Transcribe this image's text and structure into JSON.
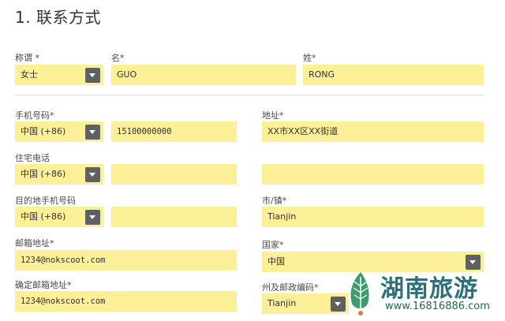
{
  "section_title": "1. 联系方式",
  "salutation": {
    "label": "称谓 *",
    "value": "女士"
  },
  "first_name": {
    "label": "名*",
    "value": "GUO"
  },
  "last_name": {
    "label": "姓*",
    "value": "RONG"
  },
  "mobile": {
    "label": "手机号码*",
    "code": "中国 (+86)",
    "number": "15100000000"
  },
  "address": {
    "label": "地址*",
    "line1": "XX市XX区XX街道",
    "line2": ""
  },
  "home_phone": {
    "label": "住宅电话",
    "code": "中国 (+86)",
    "number": ""
  },
  "dest_mobile": {
    "label": "目的地手机号码",
    "code": "中国 (+86)",
    "number": ""
  },
  "city": {
    "label": "市/镇*",
    "value": "Tianjin"
  },
  "email": {
    "label": "邮箱地址*",
    "value": "1234@nokscoot.com"
  },
  "country": {
    "label": "国家*",
    "value": "中国"
  },
  "confirm_email": {
    "label": "确定邮箱地址*",
    "value": "1234@nokscoot.com"
  },
  "state_postal": {
    "label": "州及邮政编码*",
    "state": "Tianjin"
  },
  "watermark": {
    "text": "湖南旅游",
    "url": "www.16816886.com"
  },
  "colors": {
    "field_bg": "#fbef98",
    "dropdown_btn": "#606060",
    "divider": "#d8d8d8",
    "watermark": "#2d6f7a"
  }
}
